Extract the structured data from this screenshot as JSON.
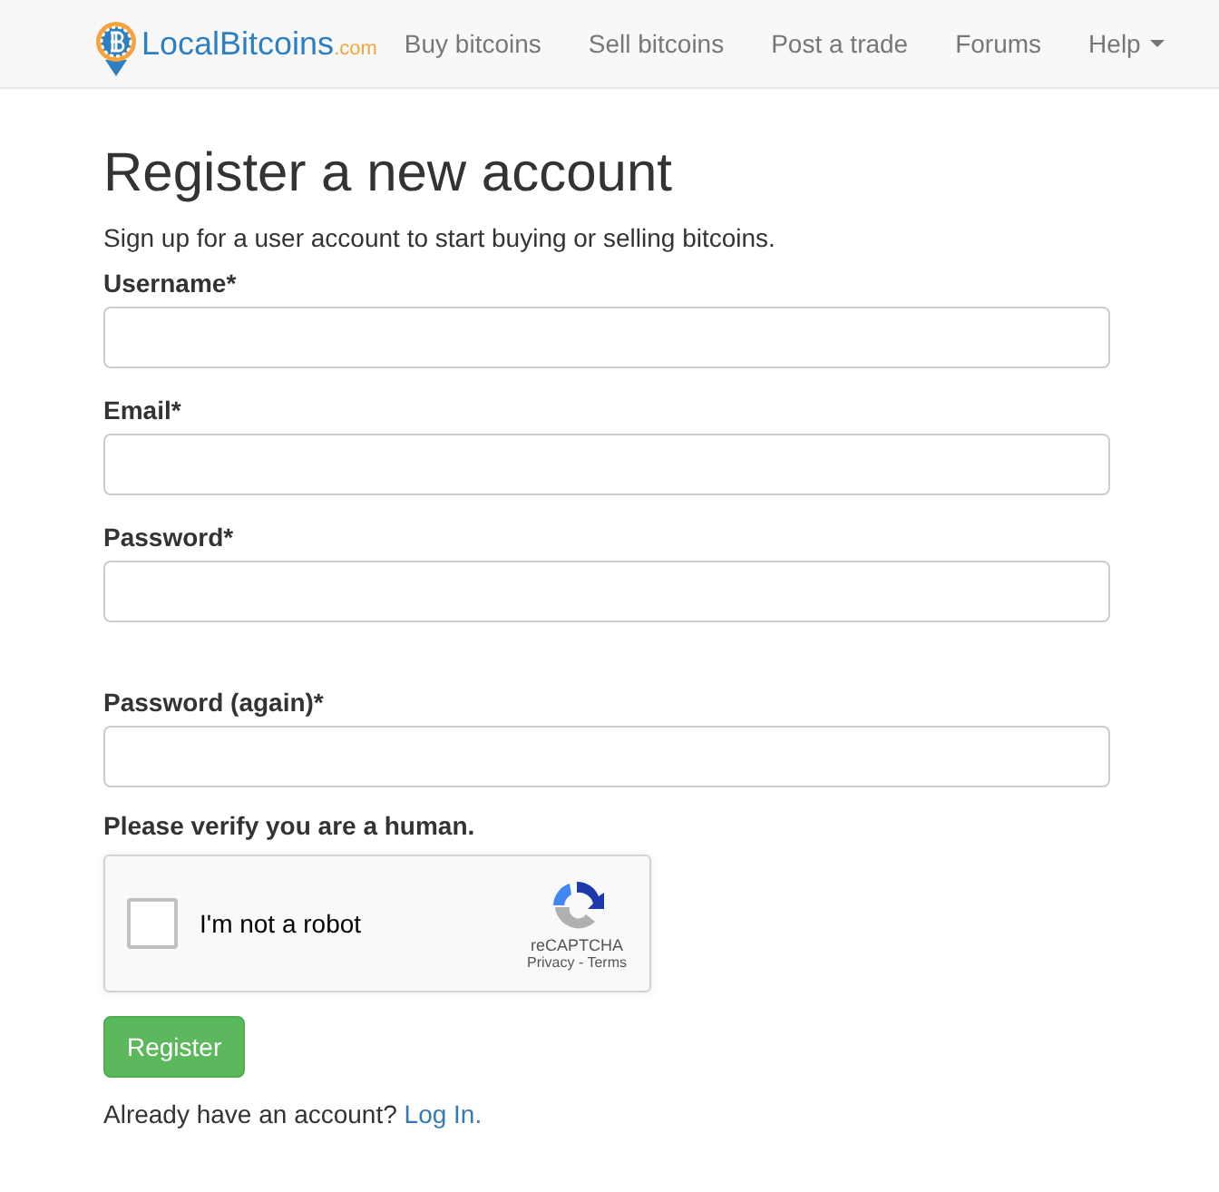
{
  "navbar": {
    "brand": "LocalBitcoins",
    "brand_suffix": ".com",
    "links": [
      {
        "label": "Buy bitcoins",
        "dropdown": false
      },
      {
        "label": "Sell bitcoins",
        "dropdown": false
      },
      {
        "label": "Post a trade",
        "dropdown": false
      },
      {
        "label": "Forums",
        "dropdown": false
      },
      {
        "label": "Help",
        "dropdown": true
      }
    ]
  },
  "title": "Register a new account",
  "subtitle": "Sign up for a user account to start buying or selling bitcoins.",
  "fields": [
    {
      "label": "Username*"
    },
    {
      "label": "Email*"
    },
    {
      "label": "Password*"
    },
    {
      "label": "Password (again)*"
    }
  ],
  "captcha": {
    "prompt": "Please verify you are a human.",
    "label": "I'm not a robot",
    "checked": false,
    "brand": "reCAPTCHA",
    "privacy": "Privacy",
    "separator": "-",
    "terms": "Terms"
  },
  "submit": "Register",
  "login": {
    "text": "Already have an account?",
    "link": "Log In."
  }
}
